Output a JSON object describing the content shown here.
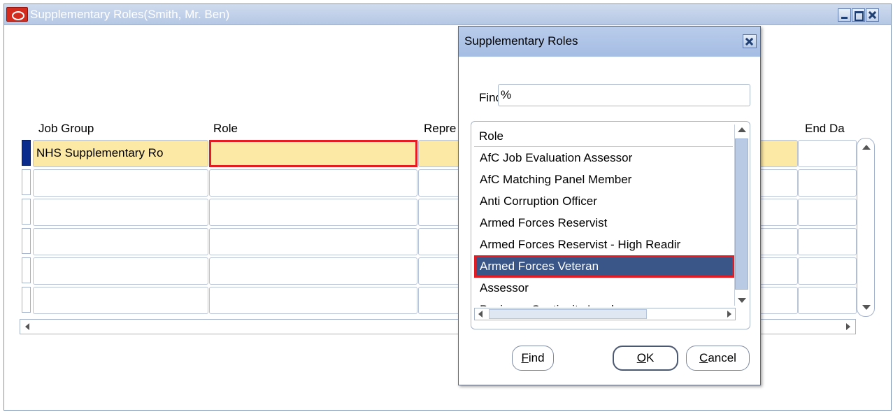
{
  "window": {
    "title": "Supplementary Roles(Smith, Mr. Ben)"
  },
  "grid": {
    "columns": [
      "Job Group",
      "Role",
      "Repre",
      "End Da"
    ],
    "first_row": {
      "job_group": "NHS Supplementary Ro",
      "role": ""
    }
  },
  "dialog": {
    "title": "Supplementary Roles",
    "find_label": "Find",
    "find_value": "%",
    "list_header": "Role",
    "items": [
      "AfC Job Evaluation Assessor",
      "AfC Matching Panel Member",
      "Anti Corruption Officer",
      "Armed Forces Reservist",
      "Armed Forces Reservist - High Readir",
      "Armed Forces Veteran",
      "Assessor",
      "Business Continuity Lead"
    ],
    "selected_item": "Armed Forces Veteran",
    "buttons": {
      "find": {
        "label": "Find",
        "mnemonic": "F"
      },
      "ok": {
        "label": "OK",
        "mnemonic": "O"
      },
      "cancel": {
        "label": "Cancel",
        "mnemonic": "C"
      }
    }
  },
  "colors": {
    "selection": "#3a5688",
    "highlight_border": "#e51b24",
    "active_cell": "#fde9a6",
    "title_bar": "#b4c7e4"
  }
}
